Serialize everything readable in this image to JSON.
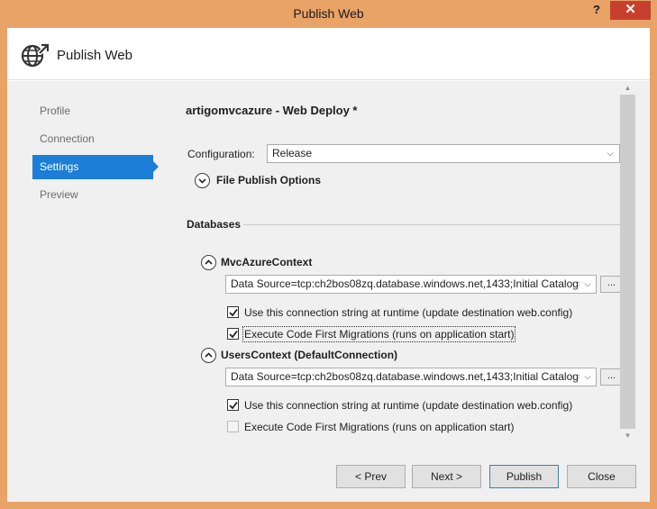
{
  "window": {
    "title": "Publish Web",
    "help_glyph": "?",
    "close_glyph": "✕"
  },
  "header": {
    "title": "Publish Web",
    "icon": "globe-publish-icon"
  },
  "nav": {
    "items": [
      {
        "label": "Profile",
        "active": false
      },
      {
        "label": "Connection",
        "active": false
      },
      {
        "label": "Settings",
        "active": true
      },
      {
        "label": "Preview",
        "active": false
      }
    ]
  },
  "content": {
    "profile_name": "artigomvcazure",
    "profile_suffix": " - Web Deploy *",
    "configuration_label": "Configuration:",
    "configuration_value": "Release",
    "file_publish_options": "File Publish Options",
    "databases_label": "Databases",
    "contexts": [
      {
        "name": "MvcAzureContext",
        "connection_string": "Data Source=tcp:ch2bos08zq.database.windows.net,1433;Initial Catalog=a",
        "browse_label": "...",
        "use_runtime": {
          "label": "Use this connection string at runtime (update destination web.config)",
          "checked": true,
          "enabled": true
        },
        "code_first": {
          "label": "Execute Code First Migrations (runs on application start)",
          "checked": true,
          "enabled": true
        }
      },
      {
        "name": "UsersContext (DefaultConnection)",
        "connection_string": "Data Source=tcp:ch2bos08zq.database.windows.net,1433;Initial Catalog=a",
        "browse_label": "...",
        "use_runtime": {
          "label": "Use this connection string at runtime (update destination web.config)",
          "checked": true,
          "enabled": true
        },
        "code_first": {
          "label": "Execute Code First Migrations (runs on application start)",
          "checked": false,
          "enabled": false
        }
      }
    ]
  },
  "buttons": {
    "prev": "< Prev",
    "next": "Next >",
    "publish": "Publish",
    "close": "Close"
  },
  "colors": {
    "accent": "#1c7ed6",
    "frame": "#e9a367",
    "close_button": "#c7402e"
  }
}
